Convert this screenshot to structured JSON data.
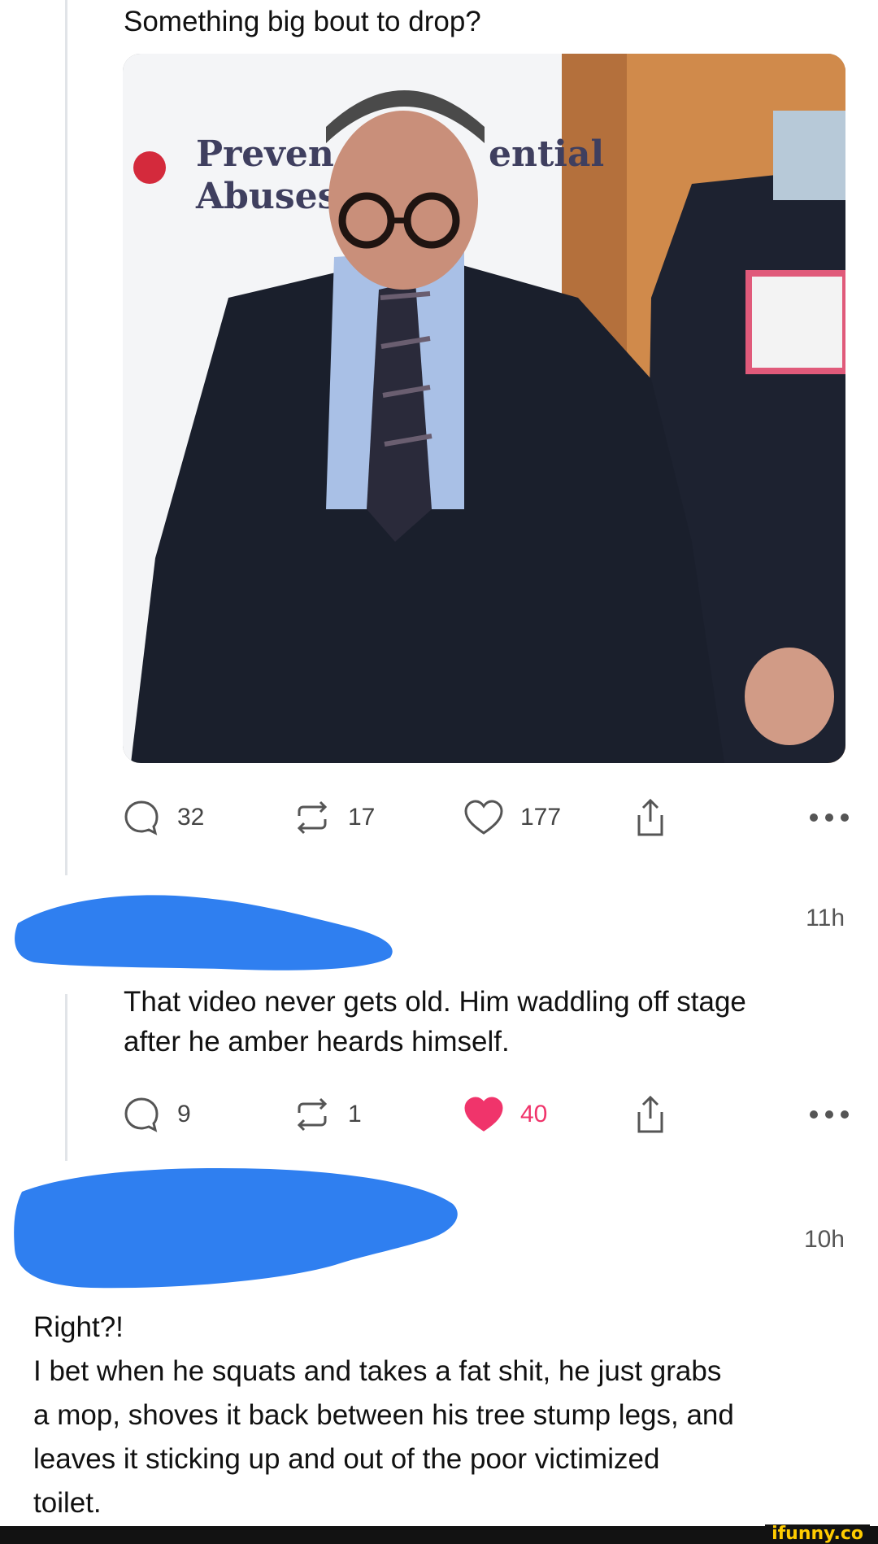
{
  "post": {
    "text": "Something big bout to drop?",
    "media_alt": "Photo of a man in a dark suit and glasses in front of a banner",
    "banner_lines": [
      "Preven",
      "ential",
      "Abuses"
    ],
    "stats": {
      "replies": "32",
      "reposts": "17",
      "likes": "177"
    }
  },
  "comment1": {
    "time": "11h",
    "text_line1": "That video never gets old. Him waddling off stage",
    "text_line2": "after he amber heards himself.",
    "stats": {
      "replies": "9",
      "reposts": "1",
      "likes": "40"
    },
    "liked": true
  },
  "comment2": {
    "time": "10h",
    "line1": "Right?!",
    "line2": "I bet when he squats and takes a fat shit, he just grabs",
    "line3": "a mop, shoves it back between his tree stump legs, and",
    "line4": "leaves it sticking up and out of the poor victimized",
    "line5": "toilet."
  },
  "watermark": "ifunny.co",
  "colors": {
    "like_active": "#f0346b",
    "scribble": "#2f7ff0",
    "thread_line": "#e1e4e8"
  },
  "icons": [
    "comment-icon",
    "repost-icon",
    "heart-icon",
    "share-icon",
    "more-icon"
  ]
}
